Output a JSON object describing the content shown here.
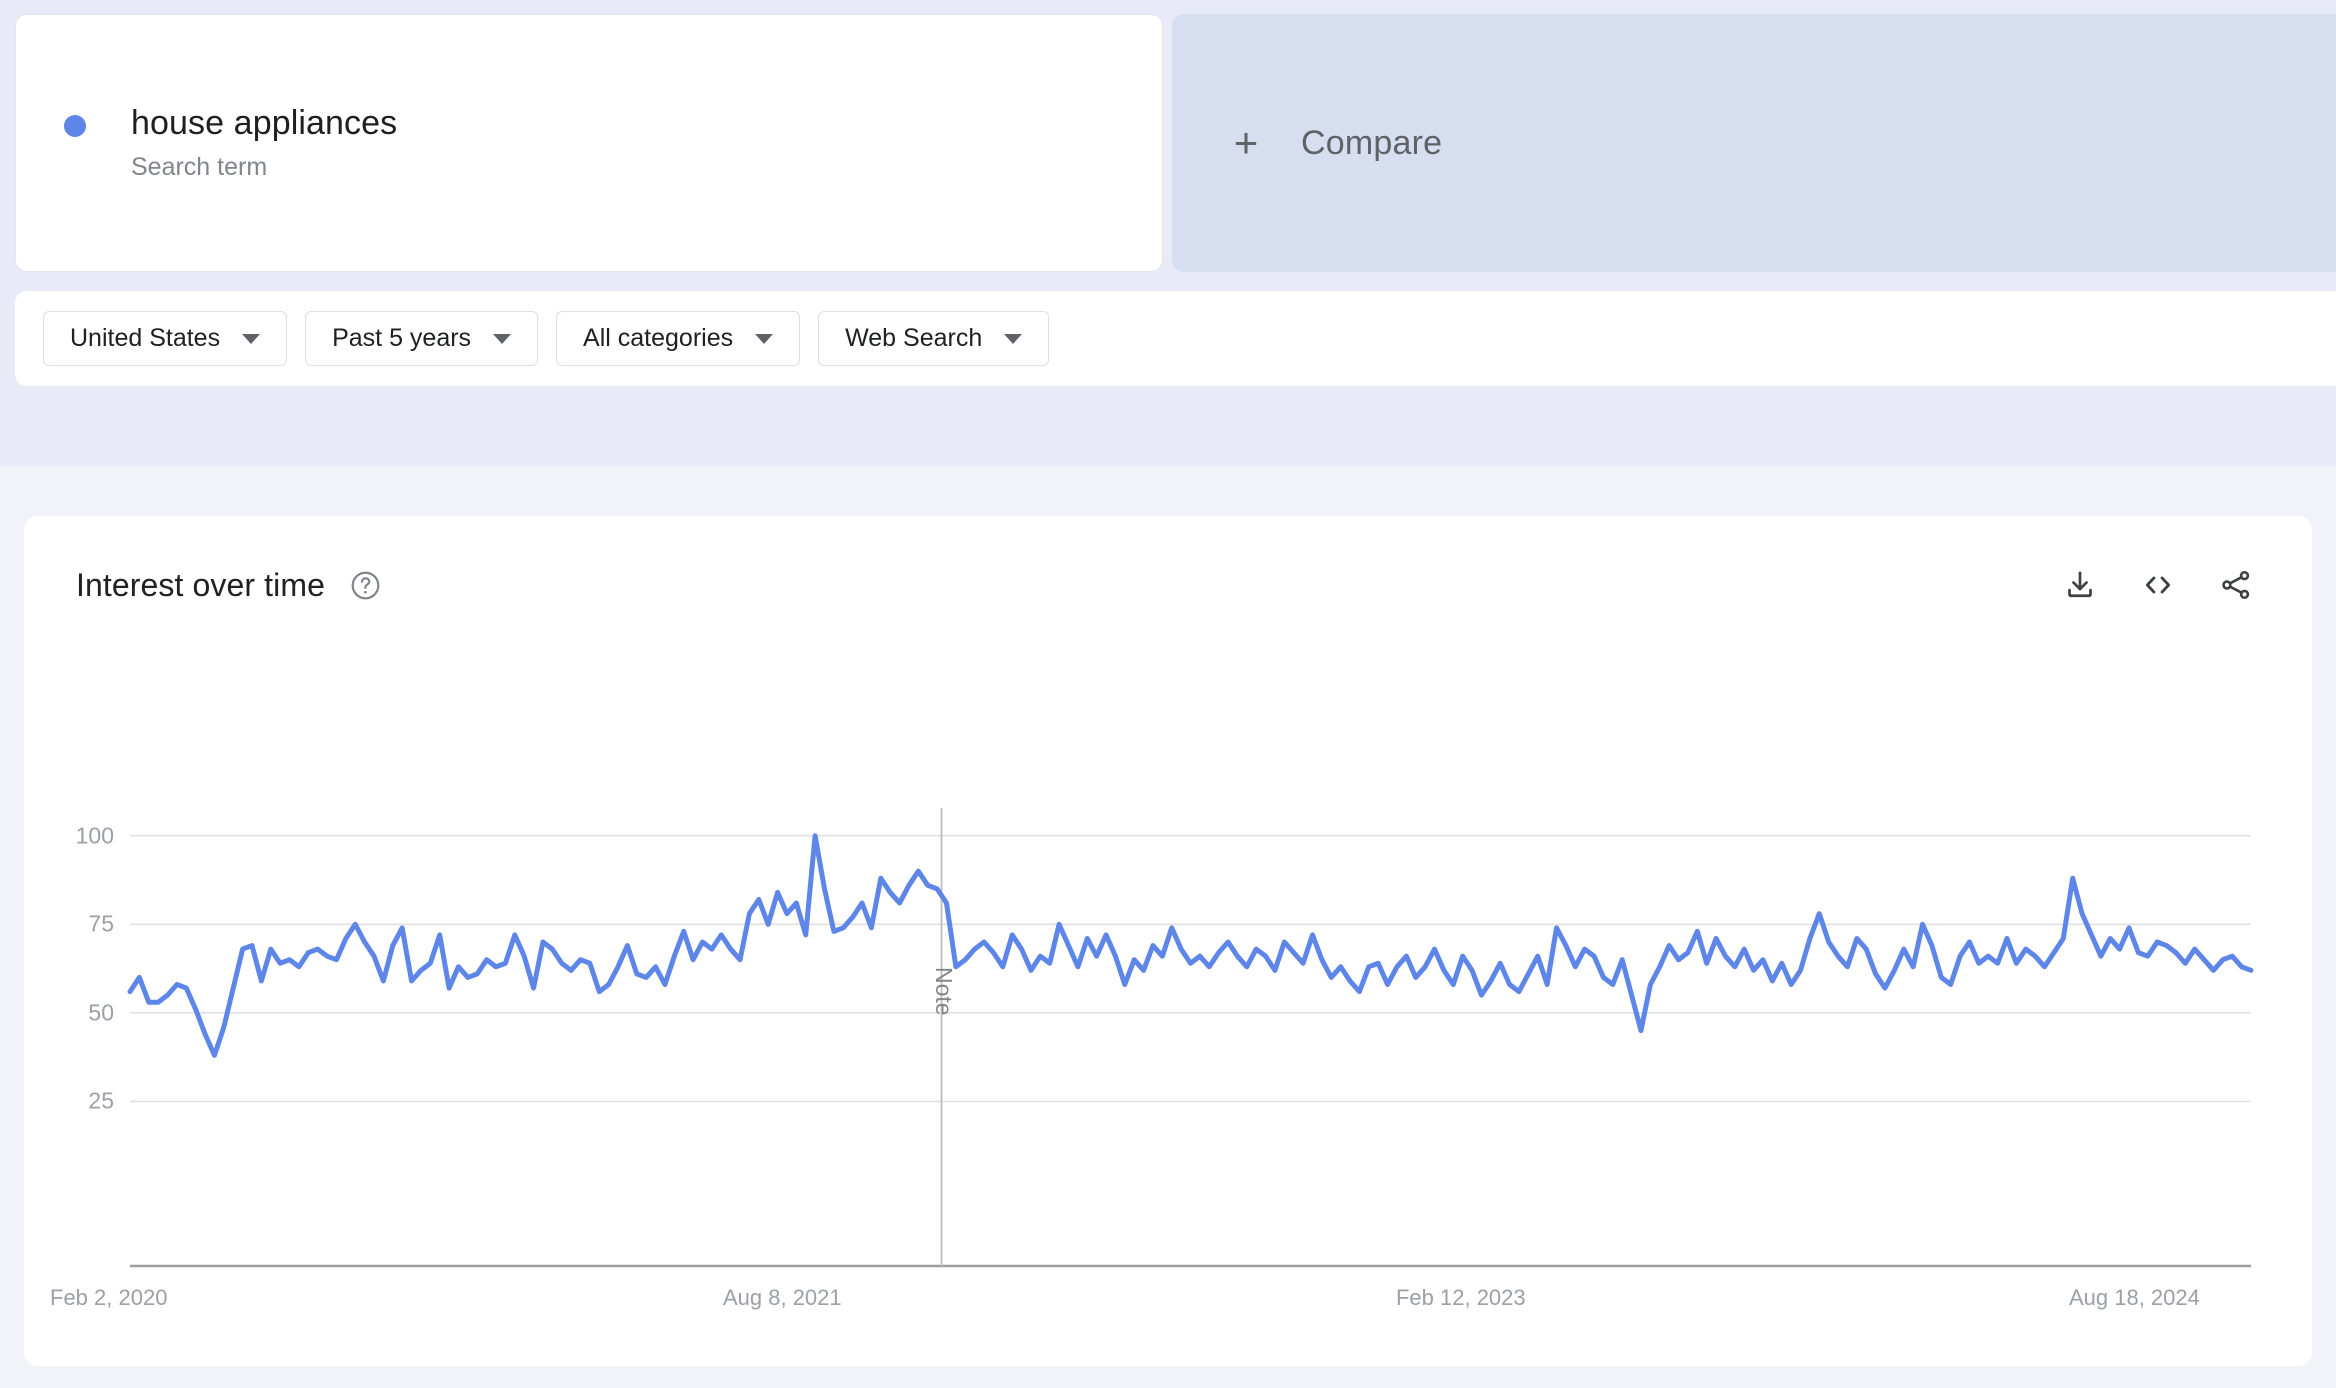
{
  "search_term": {
    "name": "house appliances",
    "type_label": "Search term",
    "dot_color": "#5e86e8"
  },
  "compare": {
    "plus": "+",
    "label": "Compare"
  },
  "filters": [
    {
      "label": "United States",
      "name": "location-filter"
    },
    {
      "label": "Past 5 years",
      "name": "time-range-filter"
    },
    {
      "label": "All categories",
      "name": "category-filter"
    },
    {
      "label": "Web Search",
      "name": "search-type-filter"
    }
  ],
  "chart_card": {
    "title": "Interest over time",
    "help_icon": "help-circle-icon",
    "actions": [
      {
        "name": "download-icon",
        "title": "Download"
      },
      {
        "name": "embed-code-icon",
        "title": "Embed"
      },
      {
        "name": "share-icon",
        "title": "Share"
      }
    ]
  },
  "chart_data": {
    "type": "line",
    "title": "Interest over time",
    "xlabel": "",
    "ylabel": "",
    "ylim": [
      0,
      105
    ],
    "yticks": [
      25,
      50,
      75,
      100
    ],
    "ytick_labels": [
      "25",
      "50",
      "75",
      "100"
    ],
    "grid": true,
    "legend_position": "none",
    "line_color": "#5e86e8",
    "line_width": 5,
    "series_name": "house appliances",
    "xtick_labels": [
      "Feb 2, 2020",
      "Aug 8, 2021",
      "Feb 12, 2023",
      "Aug 18, 2024"
    ],
    "xtick_positions": [
      0,
      0.3173,
      0.6346,
      0.9519
    ],
    "annotations": [
      {
        "label": "Note",
        "x_fraction": 0.3826
      }
    ],
    "x_start": "Feb 2, 2020",
    "x_end": "Jan 26, 2025",
    "values": [
      56,
      60,
      53,
      53,
      55,
      58,
      57,
      51,
      44,
      38,
      46,
      57,
      68,
      69,
      59,
      68,
      64,
      65,
      63,
      67,
      68,
      66,
      65,
      71,
      75,
      70,
      66,
      59,
      69,
      74,
      59,
      62,
      64,
      72,
      57,
      63,
      60,
      61,
      65,
      63,
      64,
      72,
      66,
      57,
      70,
      68,
      64,
      62,
      65,
      64,
      56,
      58,
      63,
      69,
      61,
      60,
      63,
      58,
      66,
      73,
      65,
      70,
      68,
      72,
      68,
      65,
      78,
      82,
      75,
      84,
      78,
      81,
      72,
      100,
      85,
      73,
      74,
      77,
      81,
      74,
      88,
      84,
      81,
      86,
      90,
      86,
      85,
      81,
      63,
      65,
      68,
      70,
      67,
      63,
      72,
      68,
      62,
      66,
      64,
      75,
      69,
      63,
      71,
      66,
      72,
      66,
      58,
      65,
      62,
      69,
      66,
      74,
      68,
      64,
      66,
      63,
      67,
      70,
      66,
      63,
      68,
      66,
      62,
      70,
      67,
      64,
      72,
      65,
      60,
      63,
      59,
      56,
      63,
      64,
      58,
      63,
      66,
      60,
      63,
      68,
      62,
      58,
      66,
      62,
      55,
      59,
      64,
      58,
      56,
      61,
      66,
      58,
      74,
      69,
      63,
      68,
      66,
      60,
      58,
      65,
      55,
      45,
      58,
      63,
      69,
      65,
      67,
      73,
      64,
      71,
      66,
      63,
      68,
      62,
      65,
      59,
      64,
      58,
      62,
      71,
      78,
      70,
      66,
      63,
      71,
      68,
      61,
      57,
      62,
      68,
      63,
      75,
      69,
      60,
      58,
      66,
      70,
      64,
      66,
      64,
      71,
      64,
      68,
      66,
      63,
      67,
      71,
      88,
      78,
      72,
      66,
      71,
      68,
      74,
      67,
      66,
      70,
      69,
      67,
      64,
      68,
      65,
      62,
      65,
      66,
      63,
      62
    ]
  }
}
